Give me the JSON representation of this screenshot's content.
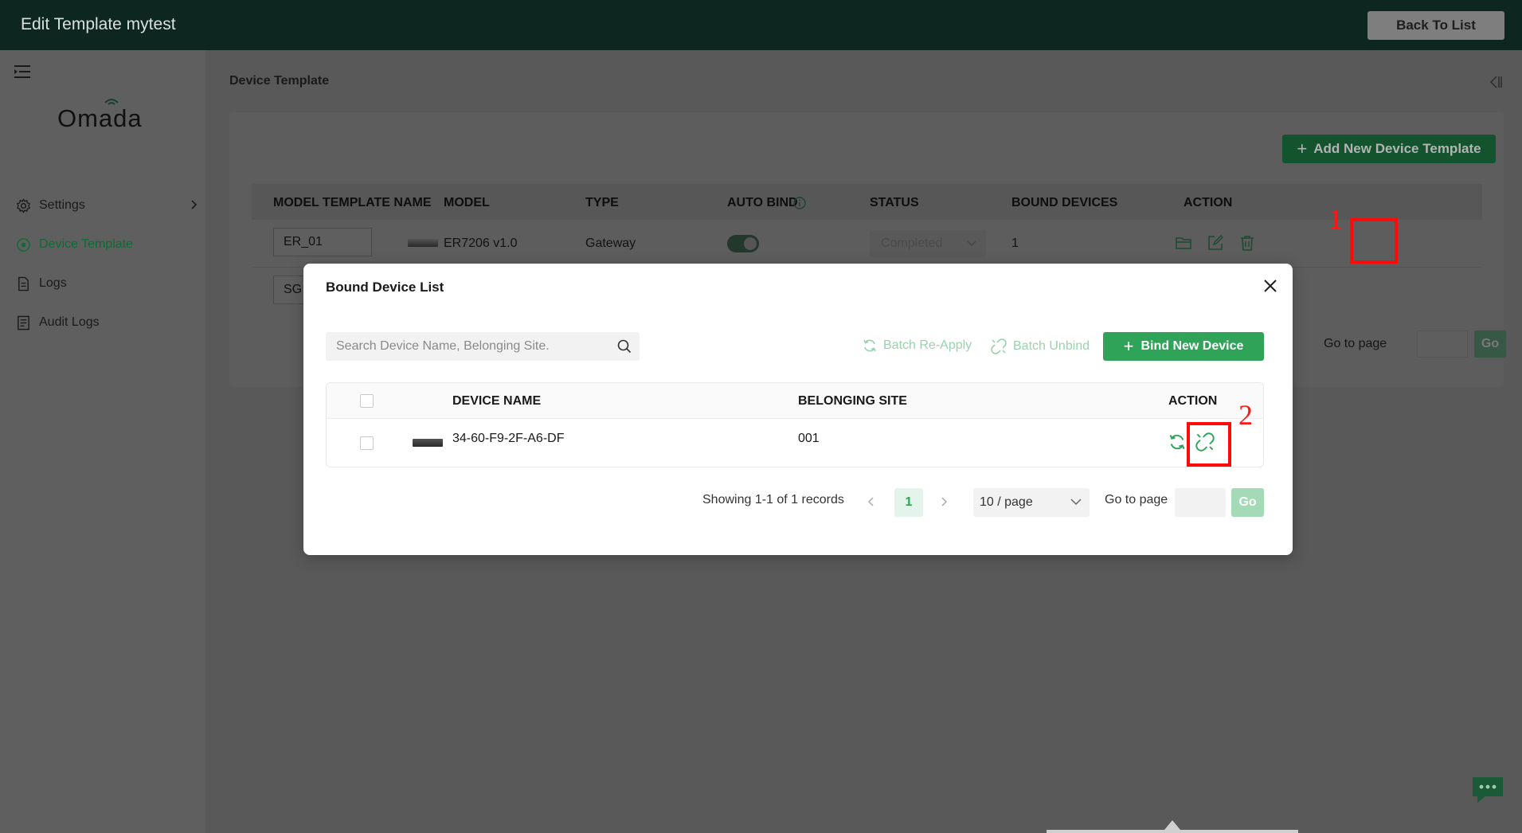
{
  "app": {
    "window_title": "Edit Template mytest",
    "back_button": "Back To List",
    "logo_text": "Omada"
  },
  "sidebar": {
    "items": [
      {
        "label": "Settings",
        "icon": "gear-icon",
        "active": false
      },
      {
        "label": "Device Template",
        "icon": "circle-target-icon",
        "active": true
      },
      {
        "label": "Logs",
        "icon": "document-icon",
        "active": false
      },
      {
        "label": "Audit Logs",
        "icon": "audit-log-icon",
        "active": false
      }
    ]
  },
  "main": {
    "heading": "Device Template",
    "add_button": "Add New Device Template",
    "table": {
      "columns": [
        "MODEL TEMPLATE NAME",
        "MODEL",
        "TYPE",
        "AUTO BIND",
        "STATUS",
        "BOUND DEVICES",
        "ACTION"
      ],
      "rows": [
        {
          "name": "ER_01",
          "model": "ER7206 v1.0",
          "type": "Gateway",
          "auto_bind": true,
          "status": "Completed",
          "bound_devices": "1"
        },
        {
          "name": "SG"
        }
      ]
    },
    "goto_label": "Go to page",
    "go_button": "Go"
  },
  "annotations": {
    "first": "1",
    "second": "2"
  },
  "modal": {
    "title": "Bound Device List",
    "search_placeholder": "Search Device Name, Belonging Site.",
    "batch_reapply": "Batch Re-Apply",
    "batch_unbind": "Batch Unbind",
    "bind_new": "Bind New Device",
    "columns": [
      "DEVICE NAME",
      "BELONGING SITE",
      "ACTION"
    ],
    "rows": [
      {
        "device_name": "34-60-F9-2F-A6-DF",
        "belonging_site": "001"
      }
    ],
    "pagination": {
      "summary": "Showing 1-1 of 1 records",
      "current_page": "1",
      "page_size": "10 / page",
      "goto_label": "Go to page",
      "go_button": "Go"
    }
  },
  "colors": {
    "topbar": "#0d2620",
    "accent_green": "#2fa358",
    "annotation_red": "#ff0a0a"
  }
}
